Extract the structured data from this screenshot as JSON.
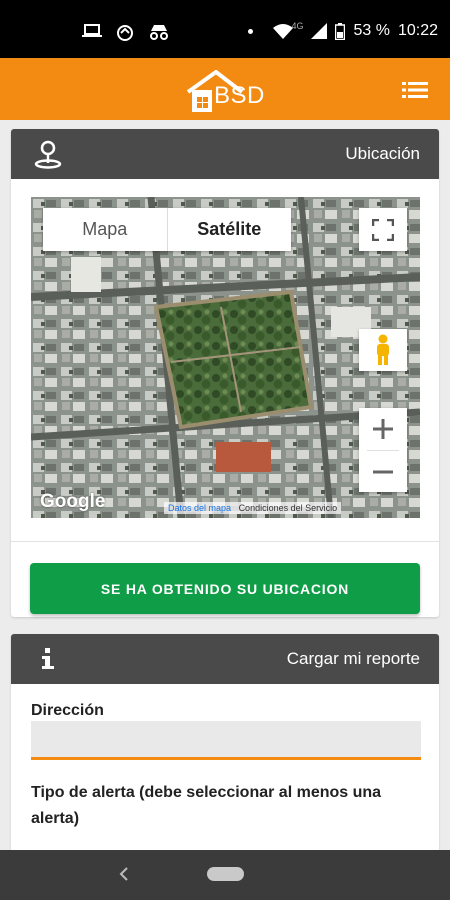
{
  "status_bar": {
    "battery": "53 %",
    "time": "10:22",
    "network": "4G",
    "icons": [
      "laptop-icon",
      "sync-icon",
      "incognito-icon",
      "dot-icon",
      "wifi-icon",
      "signal-icon",
      "battery-icon"
    ]
  },
  "app_bar": {
    "logo_text": "BSD",
    "menu_icon": "list-menu-icon",
    "color": "#f38a12"
  },
  "location_card": {
    "title": "Ubicación",
    "icon": "map-pin-icon",
    "map": {
      "type_options": [
        "Mapa",
        "Satélite"
      ],
      "selected_type": "Satélite",
      "controls": [
        "fullscreen-icon",
        "pegman-icon",
        "zoom-in-icon",
        "zoom-out-icon"
      ],
      "google_logo": "Google",
      "attribution_data": "Datos del mapa",
      "attribution_terms": "Condiciones del Servicio"
    },
    "button_label": "SE HA OBTENIDO SU UBICACION",
    "button_color": "#0f9d47"
  },
  "report_card": {
    "title": "Cargar mi reporte",
    "icon": "info-icon",
    "direccion_label": "Dirección",
    "direccion_value": "",
    "tipo_label": "Tipo de alerta (debe seleccionar al menos una alerta)"
  },
  "nav_bar": {
    "icons": [
      "back-icon",
      "home-pill"
    ]
  }
}
